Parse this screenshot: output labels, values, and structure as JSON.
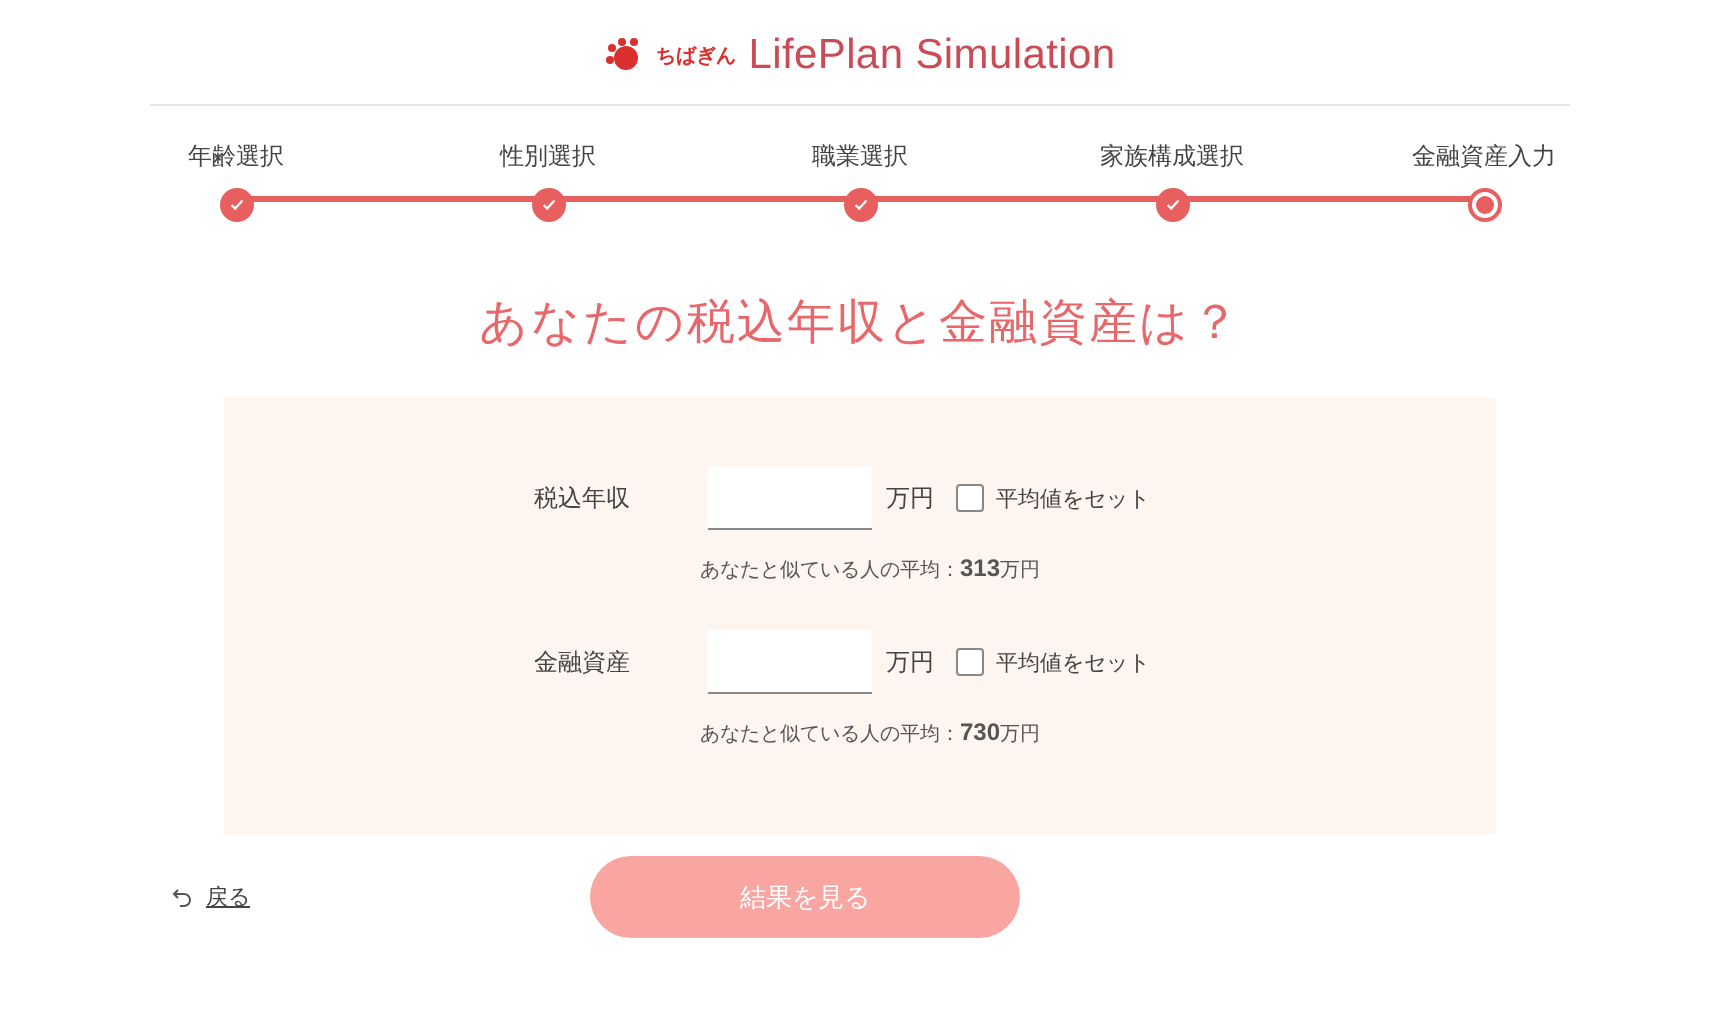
{
  "header": {
    "brand": "ちばぎん",
    "title": "LifePlan Simulation"
  },
  "steps": [
    {
      "label": "年齢選択",
      "completed": true,
      "selected": false
    },
    {
      "label": "性別選択",
      "completed": true,
      "selected": false
    },
    {
      "label": "職業選択",
      "completed": true,
      "selected": false
    },
    {
      "label": "家族構成選択",
      "completed": true,
      "selected": false
    },
    {
      "label": "金融資産入力",
      "completed": false,
      "selected": true
    }
  ],
  "heading": "あなたの税込年収と金融資産は？",
  "fields": [
    {
      "label": "税込年収",
      "unit": "万円",
      "checkbox_label": "平均値をセット",
      "checked": false,
      "average_label": "あなたと似ている人の平均：",
      "average_value": "313",
      "average_unit": "万円"
    },
    {
      "label": "金融資産",
      "unit": "万円",
      "checkbox_label": "平均値をセット",
      "checked": false,
      "average_label": "あなたと似ている人の平均：",
      "average_value": "730",
      "average_unit": "万円"
    }
  ],
  "back_link": "戻る",
  "submit": {
    "label": "結果を見る",
    "disabled": true
  }
}
